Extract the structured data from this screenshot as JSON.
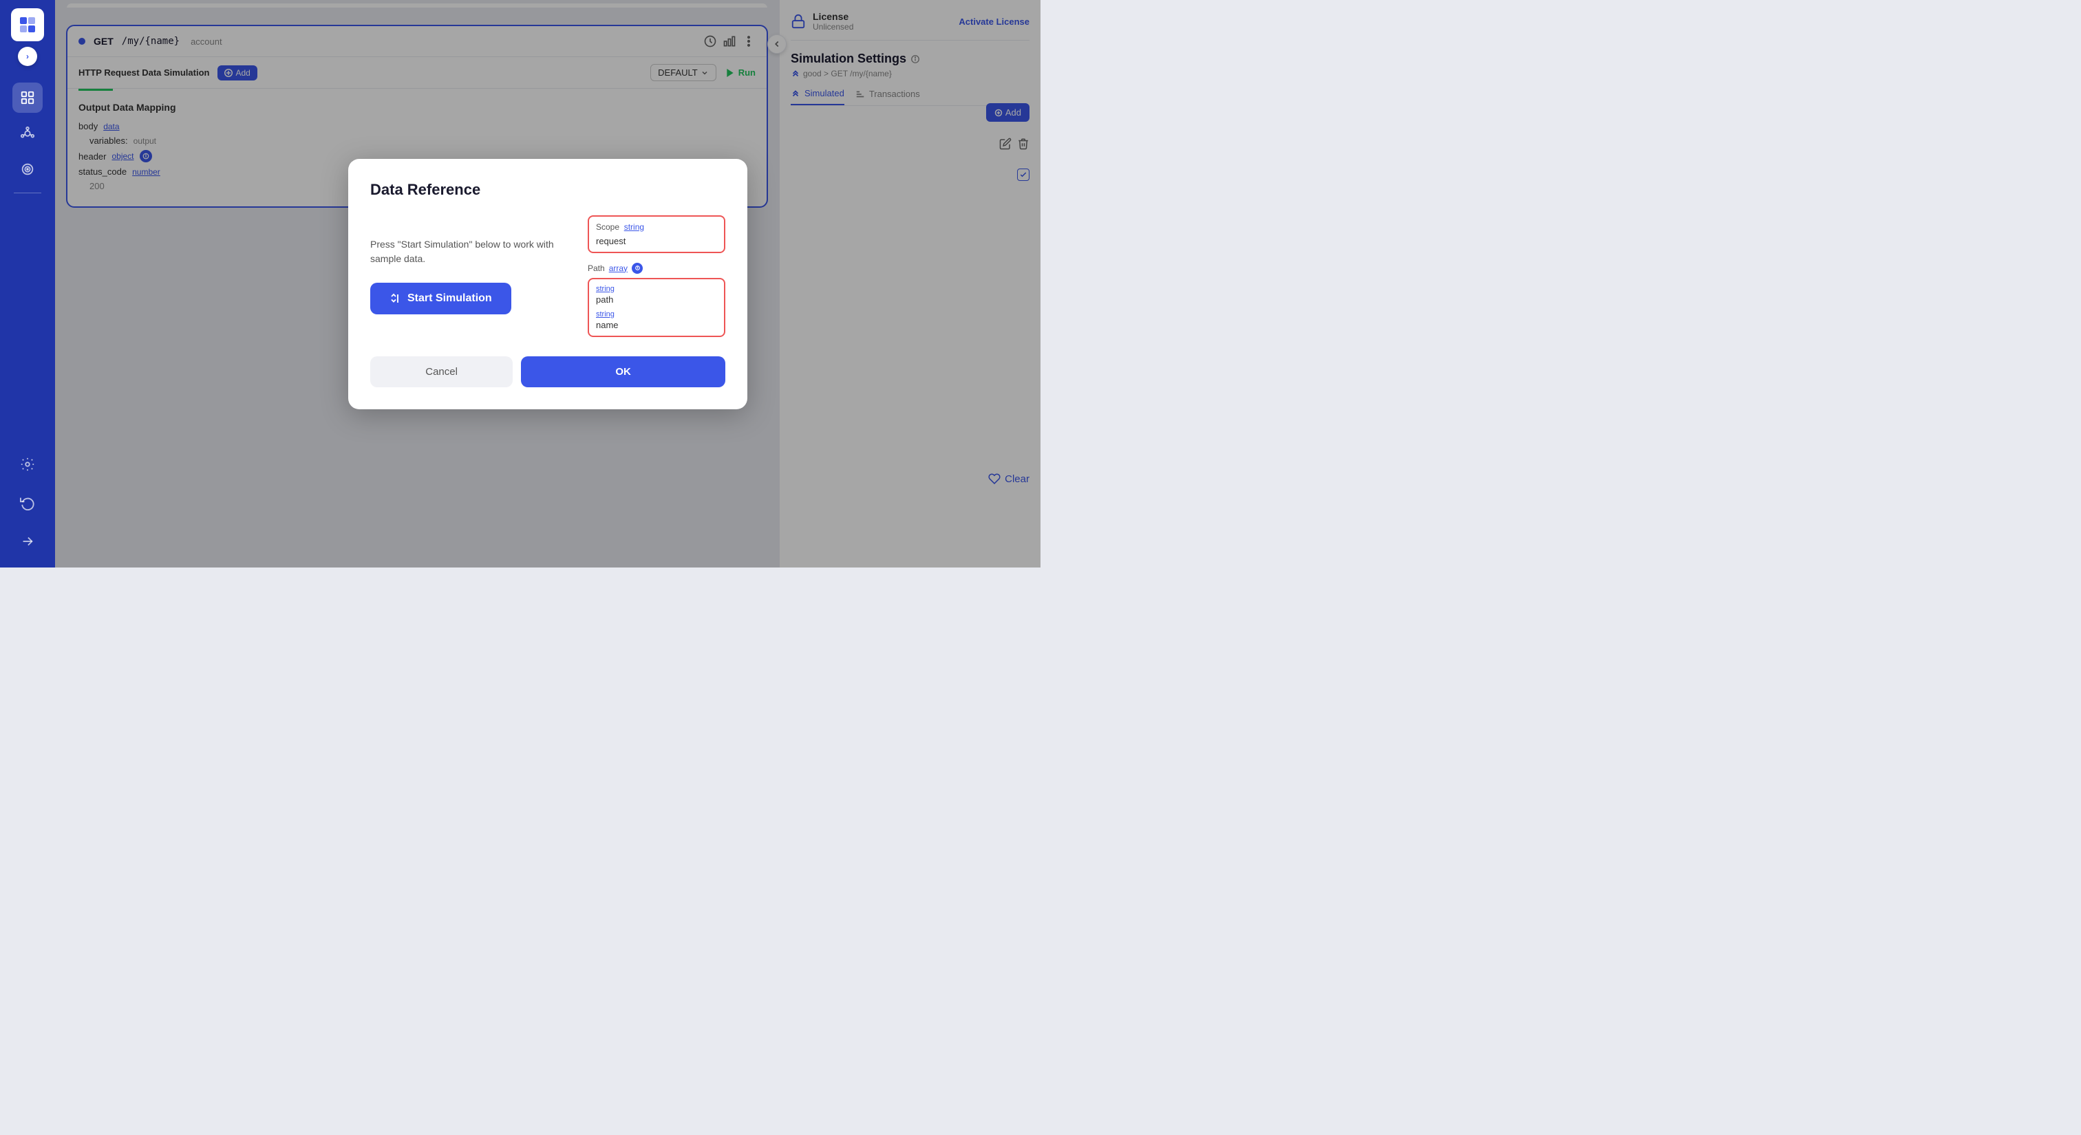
{
  "sidebar": {
    "expand_label": "›",
    "icons": [
      {
        "name": "home-icon",
        "symbol": "⌂",
        "active": false
      },
      {
        "name": "layers-icon",
        "symbol": "⊞",
        "active": true
      },
      {
        "name": "network-icon",
        "symbol": "⬡",
        "active": false
      },
      {
        "name": "target-icon",
        "symbol": "◎",
        "active": false
      },
      {
        "name": "divider1",
        "type": "divider"
      },
      {
        "name": "settings-icon",
        "symbol": "⚙",
        "active": false
      },
      {
        "name": "refresh-icon",
        "symbol": "↺",
        "active": false
      },
      {
        "name": "export-icon",
        "symbol": "→",
        "active": false
      }
    ]
  },
  "license": {
    "title": "License",
    "status": "Unlicensed",
    "activate_label": "Activate License"
  },
  "right_panel": {
    "sim_settings_title": "Simulation Settings",
    "breadcrumb": "good > GET /my/{name}",
    "tabs": [
      {
        "label": "Simulated",
        "active": true
      },
      {
        "label": "Transactions",
        "active": false
      }
    ],
    "add_label": "Add",
    "clear_label": "Clear"
  },
  "api_card": {
    "method": "GET",
    "path": "/my/{name}",
    "name": "account",
    "sim_label": "HTTP Request Data Simulation",
    "add_label": "Add",
    "default_label": "DEFAULT",
    "run_label": "Run"
  },
  "output_section": {
    "title": "Output Data Mapping",
    "rows": [
      {
        "key": "body",
        "type": "data",
        "indent": 0
      },
      {
        "key": "variables:",
        "type": "output",
        "indent": 1
      },
      {
        "key": "header",
        "type": "object",
        "indent": 0,
        "has_icon": true
      },
      {
        "key": "status_code",
        "type": "number",
        "indent": 0
      },
      {
        "key": "200",
        "type": "value",
        "indent": 1
      }
    ]
  },
  "modal": {
    "title": "Data Reference",
    "description": "Press \"Start Simulation\" below to work with sample data.",
    "start_simulation_label": "Start Simulation",
    "scope_label": "Scope",
    "scope_type": "string",
    "scope_value": "request",
    "path_label": "Path",
    "path_type": "array",
    "path_items": [
      {
        "type": "string",
        "value": "path"
      },
      {
        "type": "string",
        "value": "name"
      }
    ],
    "cancel_label": "Cancel",
    "ok_label": "OK"
  }
}
